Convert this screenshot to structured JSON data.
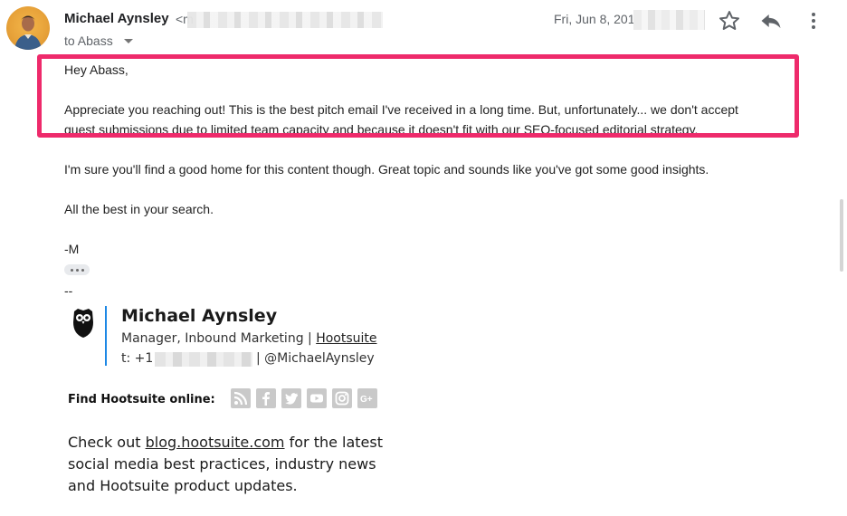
{
  "header": {
    "sender_name": "Michael Aynsley",
    "sender_email_prefix": "<m",
    "to_label": "to Abass",
    "date": "Fri, Jun 8, 201"
  },
  "icons": {
    "star": "star-icon",
    "reply": "reply-icon",
    "more": "more-vertical-icon",
    "expand": "ellipsis-icon"
  },
  "message": {
    "greeting": "Hey Abass,",
    "p1_line1": "Appreciate you reaching out! This is the best pitch email I've received in a long time. But, unfortunately... we don't accept",
    "p1_line2": "guest submissions due to limited team capacity and because it doesn't fit with our SEO-focused editorial strategy.",
    "p2": "I'm sure you'll find a good home for this content though. Great topic and sounds like you've got some good insights.",
    "p3": "All the best in your search.",
    "signoff": "-M",
    "separator": "--"
  },
  "signature": {
    "name": "Michael Aynsley",
    "title_prefix": "Manager, Inbound Marketing | ",
    "company_link": "Hootsuite",
    "phone_prefix": "t: +1",
    "handle": "| @MichaelAynsley",
    "find_label": "Find Hootsuite online:",
    "social": [
      "rss-icon",
      "facebook-icon",
      "twitter-icon",
      "youtube-icon",
      "instagram-icon",
      "google-plus-icon"
    ],
    "promo_line1_prefix": "Check out ",
    "promo_link": "blog.hootsuite.com",
    "promo_line1_suffix": " for the latest",
    "promo_line2": "social media best practices, industry news",
    "promo_line3": "and Hootsuite product updates."
  },
  "colors": {
    "highlight": "#ee2a6b",
    "signature_bar": "#1e88e5",
    "avatar_bg": "#e8a33a"
  }
}
